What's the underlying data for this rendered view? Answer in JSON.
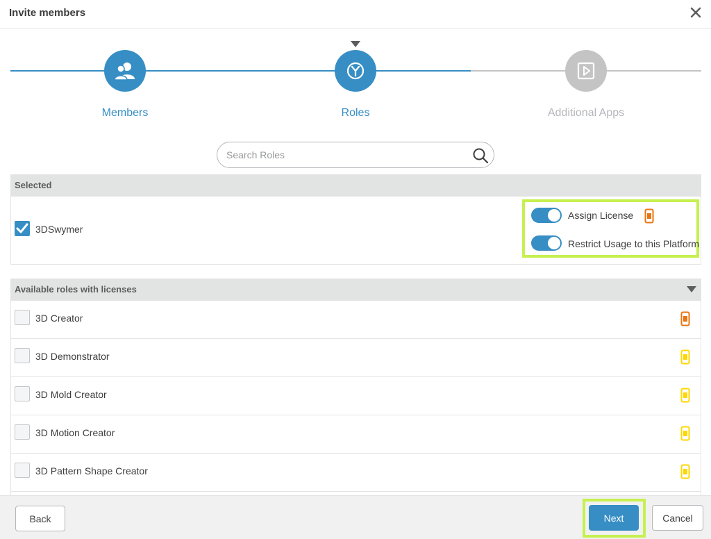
{
  "dialog": {
    "title": "Invite members",
    "close_icon": "close-icon"
  },
  "stepper": {
    "steps": [
      {
        "label": "Members",
        "icon": "members-icon",
        "state": "done",
        "color": "#368ec4"
      },
      {
        "label": "Roles",
        "icon": "roles-icon",
        "state": "active",
        "color": "#368ec4"
      },
      {
        "label": "Additional Apps",
        "icon": "apps-play-icon",
        "state": "pending",
        "color": "#c4c4c4"
      }
    ]
  },
  "search": {
    "placeholder": "Search Roles",
    "value": ""
  },
  "selected_section": {
    "header": "Selected",
    "items": [
      {
        "label": "3DSwymer",
        "checked": true
      }
    ],
    "license_options": {
      "assign_license_label": "Assign License",
      "assign_license_on": true,
      "restrict_usage_label": "Restrict Usage to this Platform",
      "restrict_usage_on": true
    }
  },
  "available_section": {
    "header": "Available roles with licenses",
    "roles": [
      {
        "label": "3D Creator",
        "checked": false,
        "license_color": "#e87511"
      },
      {
        "label": "3D Demonstrator",
        "checked": false,
        "license_color": "#ffd700"
      },
      {
        "label": "3D Mold Creator",
        "checked": false,
        "license_color": "#ffd700"
      },
      {
        "label": "3D Motion Creator",
        "checked": false,
        "license_color": "#ffd700"
      },
      {
        "label": "3D Pattern Shape Creator",
        "checked": false,
        "license_color": "#ffd700"
      }
    ]
  },
  "footer": {
    "back_label": "Back",
    "next_label": "Next",
    "cancel_label": "Cancel"
  },
  "colors": {
    "accent": "#368ec4",
    "highlight": "#c6f04f",
    "license_orange": "#e87511",
    "license_yellow": "#ffd700"
  }
}
